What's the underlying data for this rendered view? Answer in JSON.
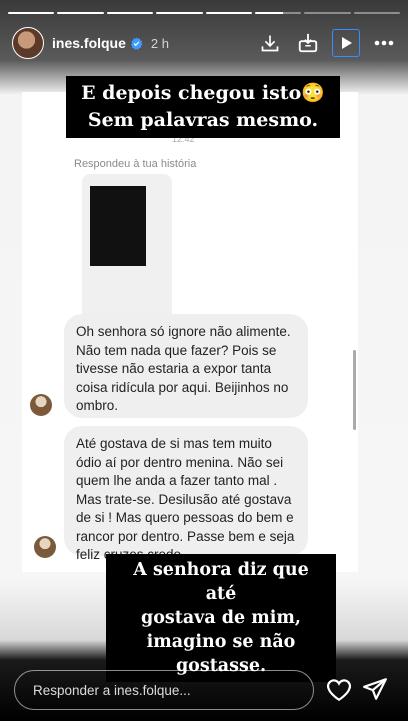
{
  "story": {
    "progress_filled": 0.7,
    "segments": 8,
    "user": {
      "username": "ines.folque",
      "verified": true,
      "time_ago": "2 h"
    },
    "header_icons": [
      "download-icon",
      "save-story-icon",
      "play-icon",
      "more-icon"
    ]
  },
  "screenshot": {
    "timestamp_clip": "12:42",
    "replied_label": "Respondeu à tua história",
    "messages": [
      {
        "text": "Oh senhora só ignore não alimente.\nNão tem nada que fazer? Pois se\ntivesse não estaria a expor tanta\ncoisa ridícula por aqui. Beijinhos no\nombro."
      },
      {
        "text": "Até gostava de si mas tem muito\nódio aí por dentro menina. Não sei\nquem lhe anda a fazer tanto mal .\nMas trate-se.  Desilusão até gostava\nde si ! Mas quero pessoas do bem e\nrancor por dentro. Passe bem e seja\nfeliz cruzes credo"
      }
    ]
  },
  "captions": {
    "top": "E depois chegou isto😳\nSem palavras mesmo.",
    "bottom": "A senhora diz que até\ngostava de mim,\nimagino se não\ngostasse."
  },
  "footer": {
    "reply_placeholder": "Responder a ines.folque..."
  },
  "colors": {
    "active_button_outline": "#3b8cff",
    "caption_bg": "#000000"
  }
}
